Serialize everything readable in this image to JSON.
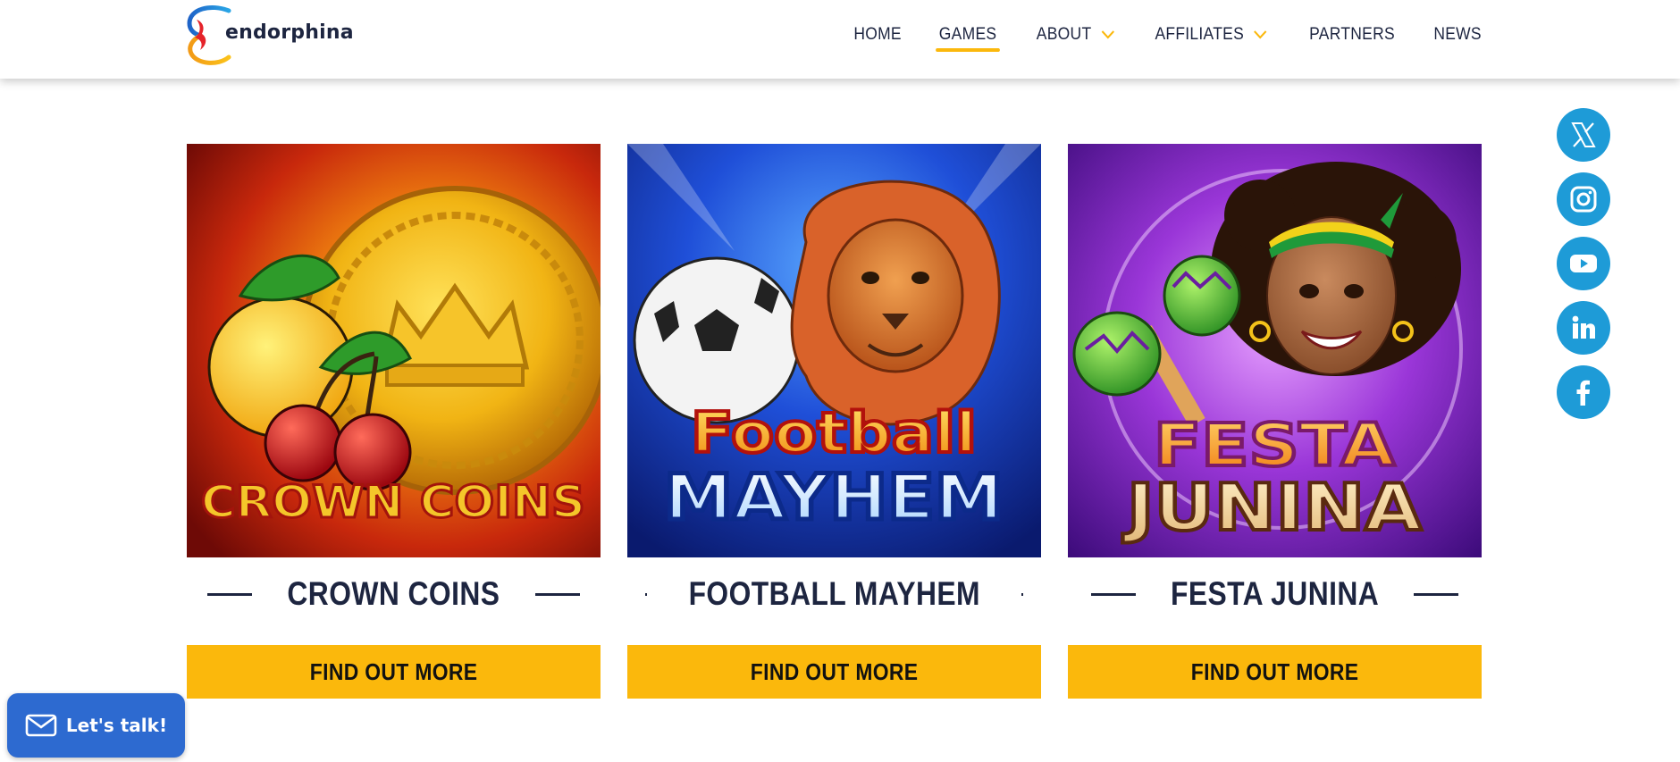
{
  "header": {
    "logo_text": "endorphina",
    "nav": [
      {
        "label": "HOME",
        "active": false,
        "dropdown": false
      },
      {
        "label": "GAMES",
        "active": true,
        "dropdown": false
      },
      {
        "label": "ABOUT",
        "active": false,
        "dropdown": true
      },
      {
        "label": "AFFILIATES",
        "active": false,
        "dropdown": true
      },
      {
        "label": "PARTNERS",
        "active": false,
        "dropdown": false
      },
      {
        "label": "NEWS",
        "active": false,
        "dropdown": false
      }
    ]
  },
  "games": [
    {
      "title": "CROWN COINS",
      "art_text": "CROWN COINS",
      "button": "FIND OUT MORE"
    },
    {
      "title": "FOOTBALL MAYHEM",
      "art_text_1": "Football",
      "art_text_2": "MAYHEM",
      "button": "FIND OUT MORE"
    },
    {
      "title": "FESTA JUNINA",
      "art_text_1": "FESTA",
      "art_text_2": "JUNINA",
      "button": "FIND OUT MORE"
    }
  ],
  "social": [
    {
      "name": "x",
      "icon": "x-icon"
    },
    {
      "name": "instagram",
      "icon": "instagram-icon"
    },
    {
      "name": "youtube",
      "icon": "youtube-icon"
    },
    {
      "name": "linkedin",
      "icon": "linkedin-icon"
    },
    {
      "name": "facebook",
      "icon": "facebook-icon"
    }
  ],
  "chat": {
    "label": "Let's talk!",
    "icon": "envelope-icon"
  },
  "colors": {
    "accent": "#fbb80c",
    "navy": "#1d2540",
    "social_blue": "#1e9bd7",
    "chat_blue": "#2d6ad0"
  }
}
